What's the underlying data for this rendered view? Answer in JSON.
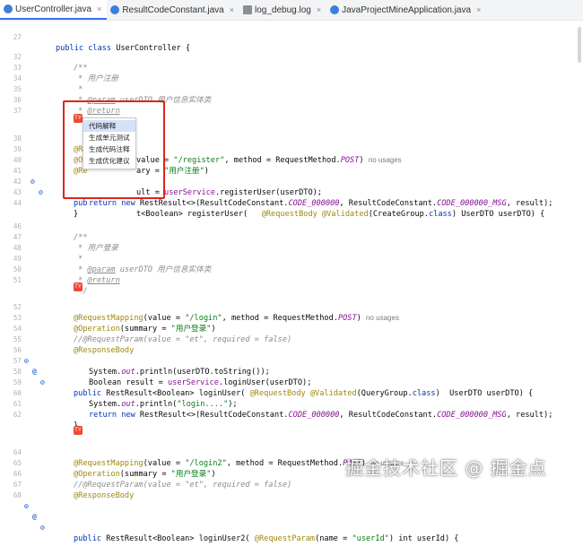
{
  "tabs": [
    {
      "label": "UserController.java",
      "active": true,
      "color": "#3d7fd9"
    },
    {
      "label": "ResultCodeConstant.java",
      "active": false,
      "color": "#3d7fd9"
    },
    {
      "label": "log_debug.log",
      "active": false,
      "color": "#8a8f96"
    },
    {
      "label": "JavaProjectMineApplication.java",
      "active": false,
      "color": "#3d7fd9"
    }
  ],
  "close_glyph": "×",
  "type_badge": "TY",
  "context_menu": {
    "items": [
      "代码解释",
      "生成单元测试",
      "生成代码注释",
      "生成优化建议"
    ],
    "selected_index": 0
  },
  "watermark": "掘金技术社区 @ 掘金点",
  "lines": {
    "l27": {
      "num": "27",
      "t1": "public class ",
      "t2": "UserController {"
    },
    "l32": {
      "num": "32",
      "t": "/**"
    },
    "l33": {
      "num": "33",
      "t": " * 用户注册"
    },
    "l34": {
      "num": "34",
      "t": " *"
    },
    "l35": {
      "num": "35",
      "t1": " * ",
      "t2": "@param",
      "t3": " userDTO ",
      "t4": "用户信息实体类"
    },
    "l36": {
      "num": "36",
      "t1": " * ",
      "t2": "@return"
    },
    "l37": {
      "num": "37",
      "t": " */"
    },
    "l38": {
      "num": "38",
      "t1": "@Re",
      "t2": "value = ",
      "t3": "\"/register\"",
      "t4": ", method = RequestMethod.",
      "t5": "POST",
      "t6": ")",
      "hint": "no usages"
    },
    "l39": {
      "num": "39",
      "t1": "@Op",
      "t2": "ary = ",
      "t3": "\"用户注册\"",
      "t4": ")"
    },
    "l40": {
      "num": "40",
      "t": "@Re"
    },
    "l41": {
      "num": "41",
      "t1": "pub",
      "t2": "t<Boolean> registerUser(   ",
      "t3": "@RequestBody @Validated",
      "t4": "(CreateGroup.",
      "t5": "class",
      "t6": ") UserDTO userDTO) {"
    },
    "l42": {
      "num": "42",
      "t1": "ult = ",
      "t2": "userService",
      "t3": ".registerUser(userDTO);"
    },
    "l43": {
      "num": "43",
      "t1": "return new ",
      "t2": "RestResult<>(ResultCodeConstant.",
      "t3": "CODE_000000",
      "t4": ", ResultCodeConstant.",
      "t5": "CODE_000000_MSG",
      "t6": ", result);"
    },
    "l44": {
      "num": "44",
      "t": "}"
    },
    "l46": {
      "num": "46",
      "t": "/**"
    },
    "l47": {
      "num": "47",
      "t": " * 用户登录"
    },
    "l48": {
      "num": "48",
      "t": " *"
    },
    "l49": {
      "num": "49",
      "t1": " * ",
      "t2": "@param",
      "t3": " userDTO ",
      "t4": "用户信息实体类"
    },
    "l50": {
      "num": "50",
      "t1": " * ",
      "t2": "@return"
    },
    "l51": {
      "num": "51",
      "t": " */"
    },
    "l52": {
      "num": "52",
      "t1": "@RequestMapping",
      "t2": "(value = ",
      "t3": "\"/login\"",
      "t4": ", method = RequestMethod.",
      "t5": "POST",
      "t6": ")",
      "hint": "no usages"
    },
    "l53": {
      "num": "53",
      "t1": "@Operation",
      "t2": "(summary = ",
      "t3": "\"用户登录\"",
      "t4": ")"
    },
    "l54": {
      "num": "54",
      "t": "//@RequestParam(value = \"et\", required = false)"
    },
    "l55": {
      "num": "55",
      "t": "@ResponseBody"
    },
    "l56": {
      "num": "56",
      "t1": "public ",
      "t2": "RestResult<Boolean> loginUser( ",
      "t3": "@RequestBody @Validated",
      "t4": "(QueryGroup.",
      "t5": "class",
      "t6": ")  UserDTO userDTO) {"
    },
    "l57": {
      "num": "57",
      "t1": "System.",
      "t2": "out",
      "t3": ".println(userDTO.toString());"
    },
    "l58": {
      "num": "58",
      "t1": "Boolean result = ",
      "t2": "userService",
      "t3": ".loginUser(userDTO);"
    },
    "l59": {
      "num": "59",
      "t": ""
    },
    "l60": {
      "num": "60",
      "t1": "System.",
      "t2": "out",
      "t3": ".println(",
      "t4": "\"login....\"",
      "t5": ");"
    },
    "l61": {
      "num": "61",
      "t1": "return new ",
      "t2": "RestResult<>(ResultCodeConstant.",
      "t3": "CODE_000000",
      "t4": ", ResultCodeConstant.",
      "t5": "CODE_000000_MSG",
      "t6": ", result);"
    },
    "l62": {
      "num": "62",
      "t": "}"
    },
    "l64": {
      "num": "64",
      "t1": "@RequestMapping",
      "t2": "(value = ",
      "t3": "\"/login2\"",
      "t4": ", method = RequestMethod.",
      "t5": "POST",
      "t6": ")",
      "hint": "no usages"
    },
    "l65": {
      "num": "65",
      "t1": "@Operation",
      "t2": "(summary = ",
      "t3": "\"用户登录\"",
      "t4": ")"
    },
    "l66": {
      "num": "66",
      "t": "//@RequestParam(value = \"et\", required = false)"
    },
    "l67": {
      "num": "67",
      "t": "@ResponseBody"
    },
    "l68": {
      "num": "68",
      "t1": "public ",
      "t2": "RestResult<Boolean> loginUser2( ",
      "t3": "@RequestParam",
      "t4": "(name = ",
      "t5": "\"userId\"",
      "t6": ") int userId) {"
    }
  },
  "gutter_icons": {
    "run_icon": "⊙",
    "mapping_icon": "⊘",
    "link_icon": "@"
  }
}
